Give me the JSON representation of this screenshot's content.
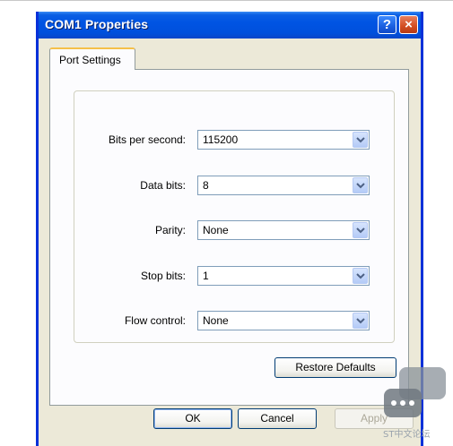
{
  "window": {
    "title": "COM1 Properties",
    "help_symbol": "?",
    "close_symbol": "×"
  },
  "tabs": [
    {
      "label": "Port Settings",
      "selected": true
    }
  ],
  "settings": [
    {
      "label": "Bits per second:",
      "value": "115200"
    },
    {
      "label": "Data bits:",
      "value": "8"
    },
    {
      "label": "Parity:",
      "value": "None"
    },
    {
      "label": "Stop bits:",
      "value": "1"
    },
    {
      "label": "Flow control:",
      "value": "None"
    }
  ],
  "buttons": {
    "restore_defaults": "Restore Defaults",
    "ok": "OK",
    "cancel": "Cancel",
    "apply": "Apply"
  },
  "watermark": {
    "text": "ST中文论坛"
  },
  "colors": {
    "titlebar": "#0054e3",
    "window_border": "#0831d9",
    "dialog_face": "#ece9d8",
    "tab_highlight": "#f5c04a"
  },
  "icons": {
    "dropdown": "chevron-down-icon",
    "help": "help-icon",
    "close": "close-icon",
    "chat": "chat-bubble-icon"
  }
}
